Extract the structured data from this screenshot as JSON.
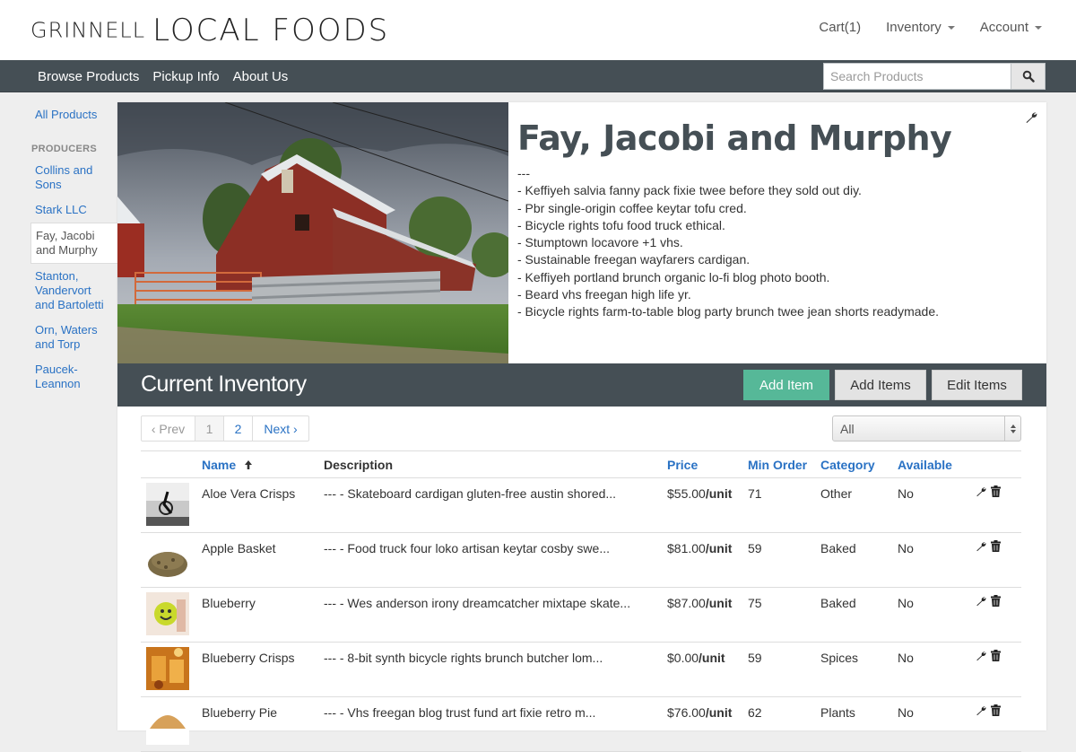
{
  "header": {
    "logo_small": "GRINNELL",
    "logo_big": "LOCAL FOODS",
    "cart_label": "Cart(1)",
    "inventory_label": "Inventory",
    "account_label": "Account"
  },
  "navbar": {
    "links": [
      "Browse Products",
      "Pickup Info",
      "About Us"
    ],
    "search_placeholder": "Search Products"
  },
  "sidebar": {
    "all_products": "All Products",
    "heading": "PRODUCERS",
    "producers": [
      "Collins and Sons",
      "Stark LLC",
      "Fay, Jacobi and Murphy",
      "Stanton, Vandervort and Bartoletti",
      "Orn, Waters and Torp",
      "Paucek-Leannon"
    ],
    "active_index": 2
  },
  "producer": {
    "name": "Fay, Jacobi and Murphy",
    "description": "---\n- Keffiyeh salvia fanny pack fixie twee before they sold out diy.\n- Pbr single-origin coffee keytar tofu cred.\n- Bicycle rights tofu food truck ethical.\n- Stumptown locavore +1 vhs.\n- Sustainable freegan wayfarers cardigan.\n- Keffiyeh portland brunch organic lo-fi blog photo booth.\n- Beard vhs freegan high life yr.\n- Bicycle rights farm-to-table blog party brunch twee jean shorts readymade."
  },
  "inventory": {
    "title": "Current Inventory",
    "add_item": "Add Item",
    "add_items": "Add Items",
    "edit_items": "Edit Items",
    "pager": {
      "prev": "‹ Prev",
      "page1": "1",
      "page2": "2",
      "next": "Next ›"
    },
    "filter_value": "All",
    "columns": {
      "name": "Name",
      "description": "Description",
      "price": "Price",
      "min_order": "Min Order",
      "category": "Category",
      "available": "Available"
    },
    "rows": [
      {
        "name": "Aloe Vera Crisps",
        "description": "--- - Skateboard cardigan gluten-free austin shored...",
        "price": "$55.00",
        "unit": "/unit",
        "min_order": "71",
        "category": "Other",
        "available": "No"
      },
      {
        "name": "Apple Basket",
        "description": "--- - Food truck four loko artisan keytar cosby swe...",
        "price": "$81.00",
        "unit": "/unit",
        "min_order": "59",
        "category": "Baked",
        "available": "No"
      },
      {
        "name": "Blueberry",
        "description": "--- - Wes anderson irony dreamcatcher mixtape skate...",
        "price": "$87.00",
        "unit": "/unit",
        "min_order": "75",
        "category": "Baked",
        "available": "No"
      },
      {
        "name": "Blueberry Crisps",
        "description": "--- - 8-bit synth bicycle rights brunch butcher lom...",
        "price": "$0.00",
        "unit": "/unit",
        "min_order": "59",
        "category": "Spices",
        "available": "No"
      },
      {
        "name": "Blueberry Pie",
        "description": "--- - Vhs freegan blog trust fund art fixie retro m...",
        "price": "$76.00",
        "unit": "/unit",
        "min_order": "62",
        "category": "Plants",
        "available": "No"
      }
    ]
  },
  "colors": {
    "navbar": "#454f55",
    "link": "#2a72c4",
    "add_button": "#56b898"
  }
}
